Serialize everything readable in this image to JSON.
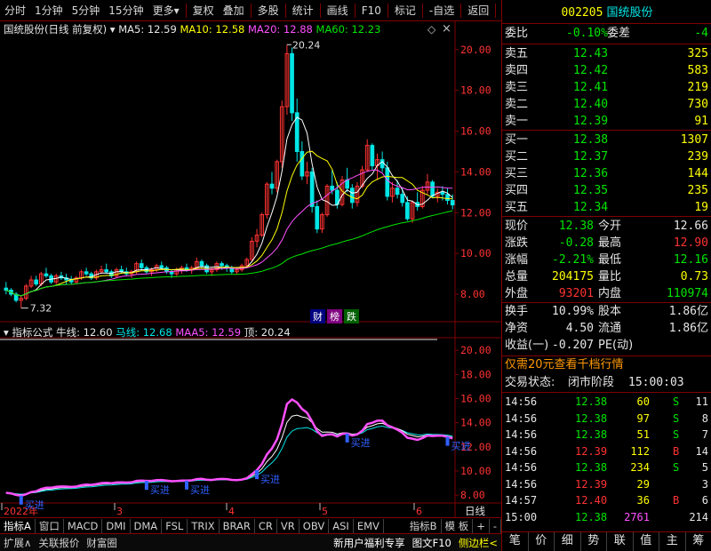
{
  "toolbar": {
    "items": [
      "分时",
      "1分钟",
      "5分钟",
      "15分钟",
      "更多",
      "复权",
      "叠加",
      "多股",
      "统计",
      "画线",
      "F10",
      "标记",
      "-自选",
      "返回"
    ]
  },
  "main_info": {
    "stock": "国统股份(日线 前复权)",
    "ma5": "MA5: 12.59",
    "ma10": "MA10: 12.58",
    "ma20": "MA20: 12.88",
    "ma60": "MA60: 12.23",
    "high_label": "20.24",
    "low_label": "7.32",
    "badges": [
      "财",
      "榜",
      "跌"
    ]
  },
  "indicator_info": {
    "name": "指标公式",
    "niu": "牛线: 12.60",
    "ma": "马线: 12.68",
    "maa5": "MAA5: 12.59",
    "ding": "顶: 20.24",
    "buy_label": "买进"
  },
  "axes": {
    "main_ticks": [
      "20.00",
      "18.00",
      "16.00",
      "14.00",
      "12.00",
      "10.00",
      "8.00"
    ],
    "ind_ticks": [
      "20.00",
      "18.00",
      "16.00",
      "14.00",
      "12.00",
      "10.00",
      "8.00"
    ],
    "x_labels": [
      "2022年",
      "3",
      "4",
      "5",
      "6"
    ],
    "period": "日线"
  },
  "tabs": [
    "指标A",
    "窗口",
    "MACD",
    "DMI",
    "DMA",
    "FSL",
    "TRIX",
    "BRAR",
    "CR",
    "VR",
    "OBV",
    "ASI",
    "EMV",
    "指标B",
    "模 板",
    "+",
    "-"
  ],
  "status": [
    "扩展∧",
    "关联报价",
    "财富圈",
    "新用户福利专享",
    "图文F10",
    "侧边栏<"
  ],
  "colors": {
    "up": "#ff3232",
    "down": "#00e6e6",
    "ma5": "#ffffff",
    "ma10": "#ffff00",
    "ma20": "#ff50ff",
    "ma60": "#00e600",
    "border": "#800000"
  },
  "quote": {
    "code": "002205",
    "name": "国统股份",
    "weibi_label": "委比",
    "weibi": "-0.10%",
    "weicha_label": "委差",
    "weicha": "-4",
    "asks": [
      {
        "label": "卖五",
        "price": "12.43",
        "vol": "325"
      },
      {
        "label": "卖四",
        "price": "12.42",
        "vol": "583"
      },
      {
        "label": "卖三",
        "price": "12.41",
        "vol": "219"
      },
      {
        "label": "卖二",
        "price": "12.40",
        "vol": "730"
      },
      {
        "label": "卖一",
        "price": "12.39",
        "vol": "91"
      }
    ],
    "bids": [
      {
        "label": "买一",
        "price": "12.38",
        "vol": "1307"
      },
      {
        "label": "买二",
        "price": "12.37",
        "vol": "239"
      },
      {
        "label": "买三",
        "price": "12.36",
        "vol": "144"
      },
      {
        "label": "买四",
        "price": "12.35",
        "vol": "235"
      },
      {
        "label": "买五",
        "price": "12.34",
        "vol": "19"
      }
    ],
    "stats": [
      {
        "l1": "现价",
        "v1": "12.38",
        "c1": "green",
        "l2": "今开",
        "v2": "12.66",
        "c2": "white"
      },
      {
        "l1": "涨跌",
        "v1": "-0.28",
        "c1": "green",
        "l2": "最高",
        "v2": "12.90",
        "c2": "red"
      },
      {
        "l1": "涨幅",
        "v1": "-2.21%",
        "c1": "green",
        "l2": "最低",
        "v2": "12.16",
        "c2": "green"
      },
      {
        "l1": "总量",
        "v1": "204175",
        "c1": "yellow",
        "l2": "量比",
        "v2": "0.73",
        "c2": "yellow"
      },
      {
        "l1": "外盘",
        "v1": "93201",
        "c1": "red",
        "l2": "内盘",
        "v2": "110974",
        "c2": "green"
      }
    ],
    "stats2": [
      {
        "l1": "换手",
        "v1": "10.99%",
        "l2": "股本",
        "v2": "1.86亿"
      },
      {
        "l1": "净资",
        "v1": "4.50",
        "l2": "流通",
        "v2": "1.86亿"
      },
      {
        "l1": "收益(一)",
        "v1": "-0.207",
        "l2": "PE(动)",
        "v2": ""
      }
    ],
    "promo": "仅需20元查看千档行情",
    "trade_state_label": "交易状态:",
    "trade_state": "闭市阶段",
    "trade_time": "15:00:03",
    "ticks": [
      {
        "t": "14:56",
        "p": "12.38",
        "v": "60",
        "bs": "S",
        "n": "11"
      },
      {
        "t": "14:56",
        "p": "12.38",
        "v": "97",
        "bs": "S",
        "n": "8"
      },
      {
        "t": "14:56",
        "p": "12.38",
        "v": "51",
        "bs": "S",
        "n": "7"
      },
      {
        "t": "14:56",
        "p": "12.39",
        "v": "112",
        "bs": "B",
        "n": "14"
      },
      {
        "t": "14:56",
        "p": "12.38",
        "v": "234",
        "bs": "S",
        "n": "5"
      },
      {
        "t": "14:56",
        "p": "12.39",
        "v": "29",
        "bs": "",
        "n": "3"
      },
      {
        "t": "14:57",
        "p": "12.40",
        "v": "36",
        "bs": "B",
        "n": "6"
      },
      {
        "t": "15:00",
        "p": "12.38",
        "v": "2761",
        "bs": "",
        "n": "214"
      }
    ],
    "nav": [
      "笔",
      "价",
      "细",
      "势",
      "联",
      "值",
      "主",
      "筹"
    ]
  },
  "chart_data": {
    "type": "candlestick",
    "y_range_main": [
      7.0,
      20.6
    ],
    "y_range_indicator": [
      7.5,
      20.6
    ],
    "candles": [
      [
        8.3,
        8.6,
        8.0,
        8.2
      ],
      [
        8.2,
        8.3,
        7.9,
        8.0
      ],
      [
        8.0,
        8.1,
        7.6,
        7.7
      ],
      [
        7.7,
        7.9,
        7.32,
        7.8
      ],
      [
        7.8,
        8.5,
        7.7,
        8.4
      ],
      [
        8.4,
        8.9,
        8.3,
        8.7
      ],
      [
        8.7,
        8.9,
        8.4,
        8.5
      ],
      [
        8.5,
        9.1,
        8.4,
        9.0
      ],
      [
        9.0,
        9.3,
        8.8,
        8.9
      ],
      [
        8.9,
        9.0,
        8.5,
        8.6
      ],
      [
        8.6,
        9.0,
        8.5,
        8.9
      ],
      [
        8.9,
        9.1,
        8.7,
        8.8
      ],
      [
        8.8,
        9.0,
        8.5,
        8.7
      ],
      [
        8.7,
        8.9,
        8.5,
        8.6
      ],
      [
        8.6,
        8.9,
        8.5,
        8.8
      ],
      [
        8.8,
        9.2,
        8.7,
        9.1
      ],
      [
        9.1,
        9.3,
        8.9,
        9.0
      ],
      [
        9.0,
        9.1,
        8.7,
        8.8
      ],
      [
        8.8,
        9.2,
        8.7,
        9.1
      ],
      [
        9.1,
        9.4,
        9.0,
        9.2
      ],
      [
        9.2,
        9.5,
        9.0,
        9.1
      ],
      [
        9.1,
        9.2,
        8.8,
        8.9
      ],
      [
        8.9,
        9.3,
        8.8,
        9.2
      ],
      [
        9.2,
        9.4,
        9.0,
        9.1
      ],
      [
        9.1,
        9.3,
        8.9,
        9.0
      ],
      [
        9.0,
        9.2,
        8.8,
        9.1
      ],
      [
        9.1,
        9.6,
        9.0,
        9.5
      ],
      [
        9.5,
        9.7,
        9.2,
        9.3
      ],
      [
        9.3,
        9.4,
        9.0,
        9.1
      ],
      [
        9.1,
        9.3,
        8.9,
        9.2
      ],
      [
        9.2,
        9.5,
        9.1,
        9.4
      ],
      [
        9.4,
        9.6,
        9.2,
        9.3
      ],
      [
        9.3,
        9.4,
        9.0,
        9.1
      ],
      [
        9.1,
        9.2,
        8.8,
        9.0
      ],
      [
        9.0,
        9.3,
        8.9,
        9.2
      ],
      [
        9.2,
        9.4,
        9.0,
        9.3
      ],
      [
        9.3,
        9.5,
        9.1,
        9.2
      ],
      [
        9.2,
        9.4,
        9.0,
        9.3
      ],
      [
        9.3,
        9.8,
        9.2,
        9.6
      ],
      [
        9.6,
        9.7,
        9.3,
        9.4
      ],
      [
        9.4,
        9.5,
        9.0,
        9.1
      ],
      [
        9.1,
        9.3,
        8.9,
        9.2
      ],
      [
        9.2,
        9.6,
        9.1,
        9.5
      ],
      [
        9.5,
        9.6,
        9.2,
        9.4
      ],
      [
        9.4,
        9.5,
        9.1,
        9.3
      ],
      [
        9.3,
        9.4,
        9.0,
        9.1
      ],
      [
        9.1,
        9.3,
        9.0,
        9.2
      ],
      [
        9.2,
        9.5,
        9.1,
        9.4
      ],
      [
        9.4,
        9.8,
        9.3,
        9.7
      ],
      [
        9.7,
        10.8,
        9.6,
        10.6
      ],
      [
        10.6,
        11.2,
        10.3,
        10.9
      ],
      [
        10.9,
        12.0,
        10.8,
        11.9
      ],
      [
        11.9,
        13.5,
        11.7,
        13.4
      ],
      [
        13.4,
        14.0,
        12.9,
        13.2
      ],
      [
        13.2,
        14.6,
        13.0,
        14.5
      ],
      [
        14.5,
        17.5,
        14.2,
        17.2
      ],
      [
        17.2,
        20.24,
        16.8,
        19.8
      ],
      [
        19.8,
        20.1,
        16.5,
        16.9
      ],
      [
        16.9,
        17.6,
        14.5,
        15.0
      ],
      [
        15.0,
        15.5,
        13.6,
        13.8
      ],
      [
        13.8,
        14.5,
        13.4,
        14.0
      ],
      [
        14.0,
        14.2,
        12.0,
        12.3
      ],
      [
        12.3,
        12.6,
        11.0,
        11.2
      ],
      [
        11.2,
        12.0,
        11.0,
        11.9
      ],
      [
        11.9,
        13.4,
        11.8,
        13.3
      ],
      [
        13.3,
        14.1,
        12.9,
        13.1
      ],
      [
        13.1,
        13.5,
        12.2,
        12.4
      ],
      [
        12.4,
        13.8,
        12.3,
        13.6
      ],
      [
        13.6,
        14.2,
        13.0,
        13.2
      ],
      [
        13.2,
        13.4,
        12.2,
        12.5
      ],
      [
        12.5,
        13.5,
        12.3,
        13.3
      ],
      [
        13.3,
        14.3,
        13.2,
        14.1
      ],
      [
        14.1,
        15.6,
        14.0,
        15.3
      ],
      [
        15.3,
        15.4,
        14.1,
        14.3
      ],
      [
        14.3,
        14.9,
        13.6,
        14.6
      ],
      [
        14.6,
        15.0,
        14.0,
        14.2
      ],
      [
        14.2,
        14.5,
        12.6,
        12.8
      ],
      [
        12.8,
        13.5,
        12.5,
        13.2
      ],
      [
        13.2,
        13.6,
        12.7,
        12.9
      ],
      [
        12.9,
        13.2,
        12.3,
        12.5
      ],
      [
        12.5,
        12.8,
        11.6,
        11.7
      ],
      [
        11.7,
        12.6,
        11.5,
        12.5
      ],
      [
        12.5,
        13.0,
        12.1,
        12.3
      ],
      [
        12.3,
        13.3,
        12.2,
        13.1
      ],
      [
        13.1,
        13.9,
        12.9,
        13.5
      ],
      [
        13.5,
        13.6,
        12.7,
        12.8
      ],
      [
        12.8,
        13.2,
        12.5,
        13.0
      ],
      [
        13.0,
        13.3,
        12.6,
        12.9
      ],
      [
        12.9,
        13.2,
        12.4,
        12.6
      ],
      [
        12.6,
        12.9,
        12.16,
        12.38
      ]
    ],
    "ma_periods": [
      5,
      10,
      20,
      60
    ],
    "indicator_series": [
      "牛线",
      "马线",
      "MAA5"
    ],
    "buy_signals_index": [
      3,
      28,
      36,
      50,
      68,
      88
    ]
  }
}
